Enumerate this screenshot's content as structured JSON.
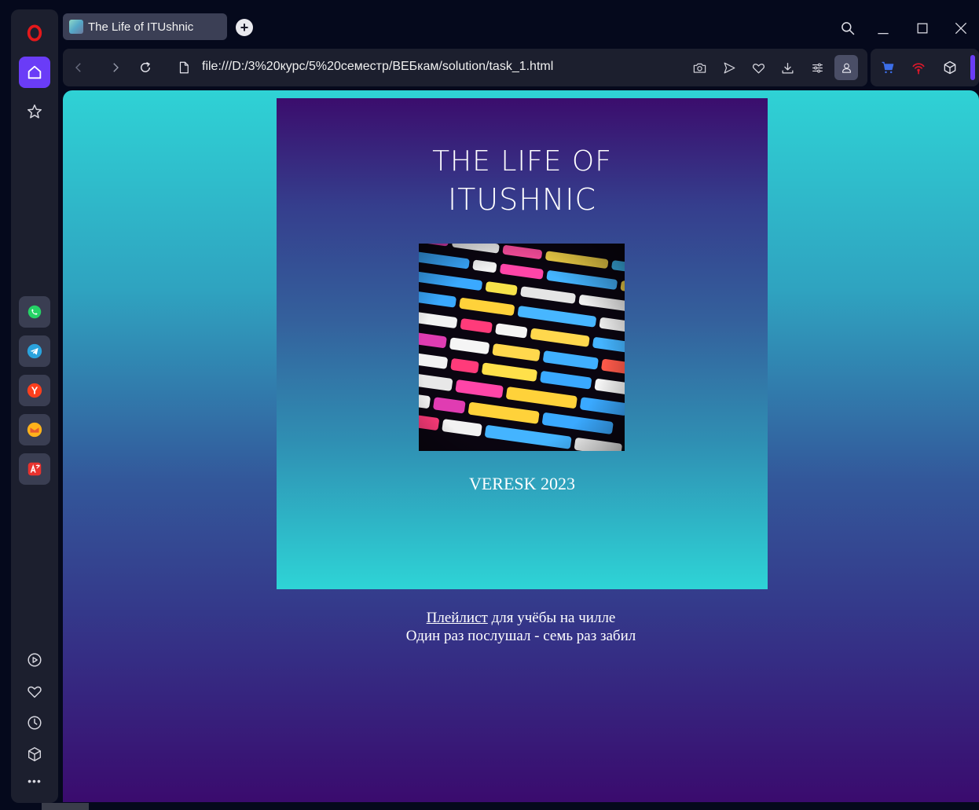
{
  "browser": {
    "tab_title": "The Life of ITUshnic",
    "new_tab_label": "+",
    "url": "file:///D:/3%20курс/5%20семестр/ВЕБкам/solution/task_1.html"
  },
  "sidebar": {
    "items": [
      "opera-logo",
      "home",
      "speed-dial-star",
      "whatsapp",
      "telegram",
      "yandex",
      "mail",
      "translator",
      "player",
      "favorites",
      "history",
      "crypto-wallet",
      "more"
    ],
    "yandex_label": "Y",
    "more_label": "•••"
  },
  "page": {
    "cover": {
      "title_line1": "THE LIFE OF",
      "title_line2": "ITUSHNIC",
      "author": "VERESK 2023"
    },
    "caption": {
      "link_text": "Плейлист",
      "line1_rest": " для учёбы на чилле",
      "line2": "Один раз послушал - семь раз забил"
    }
  },
  "colors": {
    "accent": "#6a3cf7",
    "gradient_top": "#2fd2d5",
    "gradient_bottom": "#3a0b6e"
  }
}
